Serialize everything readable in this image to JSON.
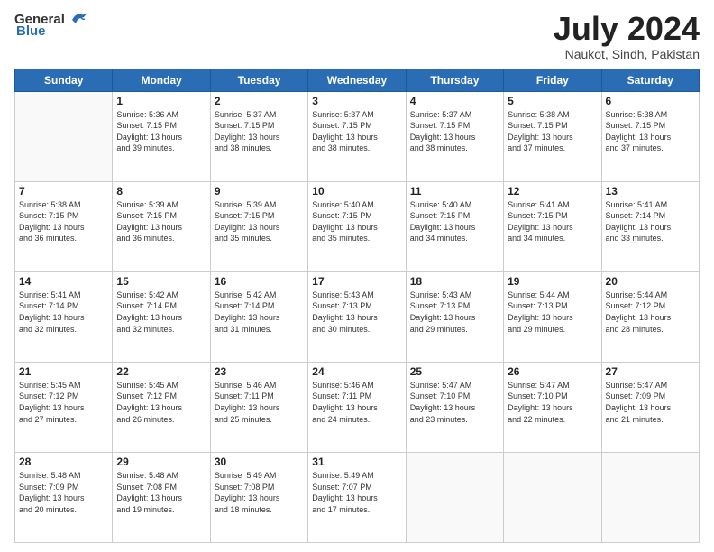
{
  "header": {
    "logo_general": "General",
    "logo_blue": "Blue",
    "month_year": "July 2024",
    "location": "Naukot, Sindh, Pakistan"
  },
  "weekdays": [
    "Sunday",
    "Monday",
    "Tuesday",
    "Wednesday",
    "Thursday",
    "Friday",
    "Saturday"
  ],
  "weeks": [
    [
      {
        "day": "",
        "sunrise": "",
        "sunset": "",
        "daylight": ""
      },
      {
        "day": "1",
        "sunrise": "Sunrise: 5:36 AM",
        "sunset": "Sunset: 7:15 PM",
        "daylight": "Daylight: 13 hours and 39 minutes."
      },
      {
        "day": "2",
        "sunrise": "Sunrise: 5:37 AM",
        "sunset": "Sunset: 7:15 PM",
        "daylight": "Daylight: 13 hours and 38 minutes."
      },
      {
        "day": "3",
        "sunrise": "Sunrise: 5:37 AM",
        "sunset": "Sunset: 7:15 PM",
        "daylight": "Daylight: 13 hours and 38 minutes."
      },
      {
        "day": "4",
        "sunrise": "Sunrise: 5:37 AM",
        "sunset": "Sunset: 7:15 PM",
        "daylight": "Daylight: 13 hours and 38 minutes."
      },
      {
        "day": "5",
        "sunrise": "Sunrise: 5:38 AM",
        "sunset": "Sunset: 7:15 PM",
        "daylight": "Daylight: 13 hours and 37 minutes."
      },
      {
        "day": "6",
        "sunrise": "Sunrise: 5:38 AM",
        "sunset": "Sunset: 7:15 PM",
        "daylight": "Daylight: 13 hours and 37 minutes."
      }
    ],
    [
      {
        "day": "7",
        "sunrise": "Sunrise: 5:38 AM",
        "sunset": "Sunset: 7:15 PM",
        "daylight": "Daylight: 13 hours and 36 minutes."
      },
      {
        "day": "8",
        "sunrise": "Sunrise: 5:39 AM",
        "sunset": "Sunset: 7:15 PM",
        "daylight": "Daylight: 13 hours and 36 minutes."
      },
      {
        "day": "9",
        "sunrise": "Sunrise: 5:39 AM",
        "sunset": "Sunset: 7:15 PM",
        "daylight": "Daylight: 13 hours and 35 minutes."
      },
      {
        "day": "10",
        "sunrise": "Sunrise: 5:40 AM",
        "sunset": "Sunset: 7:15 PM",
        "daylight": "Daylight: 13 hours and 35 minutes."
      },
      {
        "day": "11",
        "sunrise": "Sunrise: 5:40 AM",
        "sunset": "Sunset: 7:15 PM",
        "daylight": "Daylight: 13 hours and 34 minutes."
      },
      {
        "day": "12",
        "sunrise": "Sunrise: 5:41 AM",
        "sunset": "Sunset: 7:15 PM",
        "daylight": "Daylight: 13 hours and 34 minutes."
      },
      {
        "day": "13",
        "sunrise": "Sunrise: 5:41 AM",
        "sunset": "Sunset: 7:14 PM",
        "daylight": "Daylight: 13 hours and 33 minutes."
      }
    ],
    [
      {
        "day": "14",
        "sunrise": "Sunrise: 5:41 AM",
        "sunset": "Sunset: 7:14 PM",
        "daylight": "Daylight: 13 hours and 32 minutes."
      },
      {
        "day": "15",
        "sunrise": "Sunrise: 5:42 AM",
        "sunset": "Sunset: 7:14 PM",
        "daylight": "Daylight: 13 hours and 32 minutes."
      },
      {
        "day": "16",
        "sunrise": "Sunrise: 5:42 AM",
        "sunset": "Sunset: 7:14 PM",
        "daylight": "Daylight: 13 hours and 31 minutes."
      },
      {
        "day": "17",
        "sunrise": "Sunrise: 5:43 AM",
        "sunset": "Sunset: 7:13 PM",
        "daylight": "Daylight: 13 hours and 30 minutes."
      },
      {
        "day": "18",
        "sunrise": "Sunrise: 5:43 AM",
        "sunset": "Sunset: 7:13 PM",
        "daylight": "Daylight: 13 hours and 29 minutes."
      },
      {
        "day": "19",
        "sunrise": "Sunrise: 5:44 AM",
        "sunset": "Sunset: 7:13 PM",
        "daylight": "Daylight: 13 hours and 29 minutes."
      },
      {
        "day": "20",
        "sunrise": "Sunrise: 5:44 AM",
        "sunset": "Sunset: 7:12 PM",
        "daylight": "Daylight: 13 hours and 28 minutes."
      }
    ],
    [
      {
        "day": "21",
        "sunrise": "Sunrise: 5:45 AM",
        "sunset": "Sunset: 7:12 PM",
        "daylight": "Daylight: 13 hours and 27 minutes."
      },
      {
        "day": "22",
        "sunrise": "Sunrise: 5:45 AM",
        "sunset": "Sunset: 7:12 PM",
        "daylight": "Daylight: 13 hours and 26 minutes."
      },
      {
        "day": "23",
        "sunrise": "Sunrise: 5:46 AM",
        "sunset": "Sunset: 7:11 PM",
        "daylight": "Daylight: 13 hours and 25 minutes."
      },
      {
        "day": "24",
        "sunrise": "Sunrise: 5:46 AM",
        "sunset": "Sunset: 7:11 PM",
        "daylight": "Daylight: 13 hours and 24 minutes."
      },
      {
        "day": "25",
        "sunrise": "Sunrise: 5:47 AM",
        "sunset": "Sunset: 7:10 PM",
        "daylight": "Daylight: 13 hours and 23 minutes."
      },
      {
        "day": "26",
        "sunrise": "Sunrise: 5:47 AM",
        "sunset": "Sunset: 7:10 PM",
        "daylight": "Daylight: 13 hours and 22 minutes."
      },
      {
        "day": "27",
        "sunrise": "Sunrise: 5:47 AM",
        "sunset": "Sunset: 7:09 PM",
        "daylight": "Daylight: 13 hours and 21 minutes."
      }
    ],
    [
      {
        "day": "28",
        "sunrise": "Sunrise: 5:48 AM",
        "sunset": "Sunset: 7:09 PM",
        "daylight": "Daylight: 13 hours and 20 minutes."
      },
      {
        "day": "29",
        "sunrise": "Sunrise: 5:48 AM",
        "sunset": "Sunset: 7:08 PM",
        "daylight": "Daylight: 13 hours and 19 minutes."
      },
      {
        "day": "30",
        "sunrise": "Sunrise: 5:49 AM",
        "sunset": "Sunset: 7:08 PM",
        "daylight": "Daylight: 13 hours and 18 minutes."
      },
      {
        "day": "31",
        "sunrise": "Sunrise: 5:49 AM",
        "sunset": "Sunset: 7:07 PM",
        "daylight": "Daylight: 13 hours and 17 minutes."
      },
      {
        "day": "",
        "sunrise": "",
        "sunset": "",
        "daylight": ""
      },
      {
        "day": "",
        "sunrise": "",
        "sunset": "",
        "daylight": ""
      },
      {
        "day": "",
        "sunrise": "",
        "sunset": "",
        "daylight": ""
      }
    ]
  ]
}
